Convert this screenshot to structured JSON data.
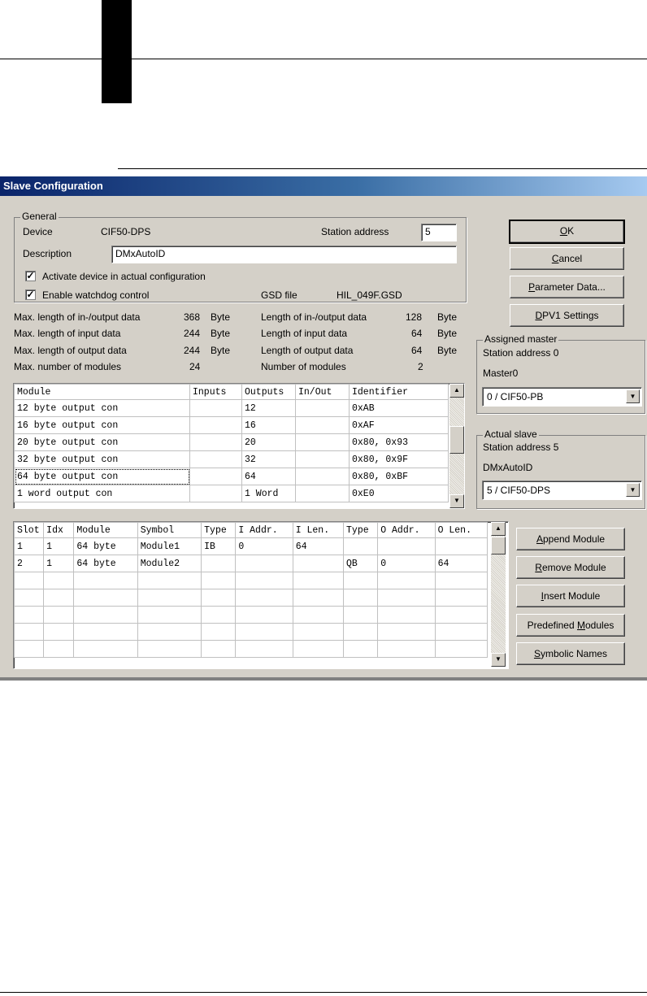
{
  "dialog": {
    "title": "Slave Configuration",
    "general": {
      "legend": "General",
      "device_label": "Device",
      "device_value": "CIF50-DPS",
      "station_address_label": "Station address",
      "station_address_value": "5",
      "description_label": "Description",
      "description_value": "DMxAutoID",
      "activate_label": "Activate device in actual configuration",
      "activate_checked": true,
      "watchdog_label": "Enable watchdog control",
      "watchdog_checked": true,
      "gsd_label": "GSD file",
      "gsd_value": "HIL_049F.GSD"
    },
    "limits": {
      "rows": [
        {
          "label": "Max. length of in-/output data",
          "value": "368",
          "unit": "Byte"
        },
        {
          "label": "Max. length of input data",
          "value": "244",
          "unit": "Byte"
        },
        {
          "label": "Max. length of output data",
          "value": "244",
          "unit": "Byte"
        },
        {
          "label": "Max. number of modules",
          "value": "24",
          "unit": ""
        }
      ]
    },
    "lengths": {
      "rows": [
        {
          "label": "Length of in-/output data",
          "value": "128",
          "unit": "Byte"
        },
        {
          "label": "Length of input data",
          "value": "64",
          "unit": "Byte"
        },
        {
          "label": "Length of output data",
          "value": "64",
          "unit": "Byte"
        },
        {
          "label": "Number of modules",
          "value": "2",
          "unit": ""
        }
      ]
    },
    "buttons": {
      "ok": "OK",
      "cancel": "Cancel",
      "parameter_data": "Parameter Data...",
      "dpv1_settings": "DPV1 Settings",
      "append_module": "Append Module",
      "remove_module": "Remove Module",
      "insert_module": "Insert Module",
      "predefined_modules": "Predefined Modules",
      "symbolic_names": "Symbolic Names"
    },
    "assigned_master": {
      "legend": "Assigned master",
      "station_address": "Station address 0",
      "name": "Master0",
      "combo_value": "0 / CIF50-PB"
    },
    "actual_slave": {
      "legend": "Actual slave",
      "station_address": "Station address 5",
      "name": "DMxAutoID",
      "combo_value": "5 / CIF50-DPS"
    },
    "module_list": {
      "headers": [
        "Module",
        "Inputs",
        "Outputs",
        "In/Out",
        "Identifier"
      ],
      "rows": [
        [
          "12 byte output con",
          "",
          "12",
          "",
          "0xAB"
        ],
        [
          "16 byte output con",
          "",
          "16",
          "",
          "0xAF"
        ],
        [
          "20 byte output con",
          "",
          "20",
          "",
          "0x80, 0x93"
        ],
        [
          "32 byte output con",
          "",
          "32",
          "",
          "0x80, 0x9F"
        ],
        [
          "64 byte output con",
          "",
          "64",
          "",
          "0x80, 0xBF"
        ],
        [
          "1  word output con",
          "",
          "1 Word",
          "",
          "0xE0"
        ]
      ]
    },
    "slot_table": {
      "headers": [
        "Slot",
        "Idx",
        "Module",
        "Symbol",
        "Type",
        "I Addr.",
        "I Len.",
        "Type",
        "O Addr.",
        "O Len."
      ],
      "rows": [
        [
          "1",
          "1",
          "64 byte",
          "Module1",
          "IB",
          "0",
          "64",
          "",
          "",
          ""
        ],
        [
          "2",
          "1",
          "64 byte",
          "Module2",
          "",
          "",
          "",
          "QB",
          "0",
          "64"
        ]
      ]
    }
  }
}
